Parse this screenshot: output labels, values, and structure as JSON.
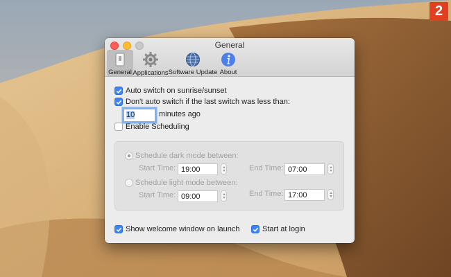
{
  "overlay": {
    "step_number": "2",
    "accent": "#e0401f"
  },
  "window": {
    "title": "General",
    "toolbar": [
      {
        "label": "General",
        "icon": "switch-icon",
        "selected": true
      },
      {
        "label": "Applications",
        "icon": "gear-icon",
        "selected": false
      },
      {
        "label": "Software Update",
        "icon": "globe-icon",
        "selected": false
      },
      {
        "label": "About",
        "icon": "info-icon",
        "selected": false
      }
    ]
  },
  "general": {
    "auto_switch": {
      "label": "Auto switch on sunrise/sunset",
      "checked": true
    },
    "dont_auto_switch": {
      "label": "Don't auto switch if the last switch was less than:",
      "checked": true
    },
    "minutes": {
      "value": "10",
      "suffix": "minutes ago"
    },
    "enable_scheduling": {
      "label": "Enable Scheduling",
      "checked": false
    },
    "schedule": {
      "dark": {
        "label": "Schedule dark mode between:",
        "selected": true,
        "start_label": "Start Time:",
        "start_value": "19:00",
        "end_label": "End Time:",
        "end_value": "07:00"
      },
      "light": {
        "label": "Schedule light mode between:",
        "selected": false,
        "start_label": "Start Time:",
        "start_value": "09:00",
        "end_label": "End Time:",
        "end_value": "17:00"
      }
    },
    "show_welcome": {
      "label": "Show welcome window on launch",
      "checked": true
    },
    "start_at_login": {
      "label": "Start at login",
      "checked": true
    }
  },
  "colors": {
    "checkbox_on": "#3b86f7",
    "focus_ring": "#7fb1f3"
  }
}
